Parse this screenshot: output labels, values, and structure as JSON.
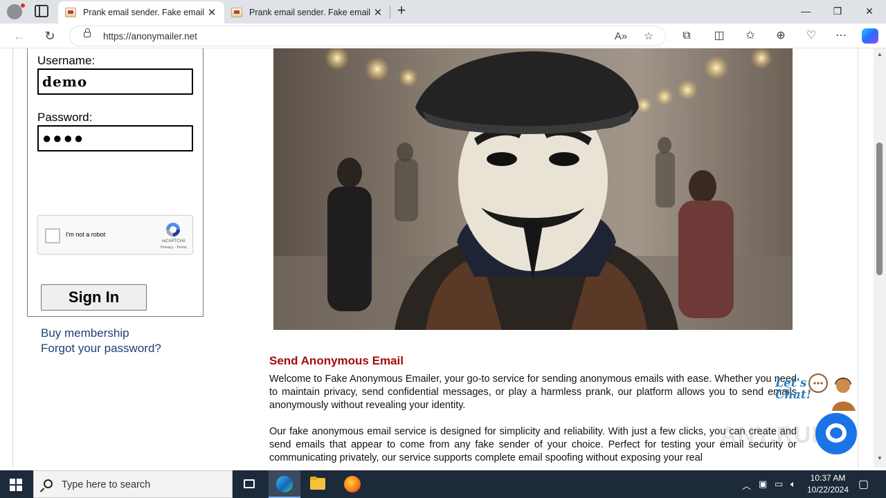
{
  "browser": {
    "tabs": [
      {
        "title": "Prank email sender. Fake email se",
        "active": true
      },
      {
        "title": "Prank email sender. Fake email se",
        "active": false
      }
    ],
    "url": "https://anonymailer.net"
  },
  "login": {
    "username_label": "Username:",
    "username_value": "demo",
    "password_label": "Password:",
    "password_value": "●●●●",
    "captcha_text": "I'm not a robot",
    "captcha_brand": "reCAPTCHA",
    "captcha_terms": "Privacy - Terms",
    "signin_label": "Sign In",
    "buy_link": "Buy membership",
    "forgot_link": "Forgot your password?"
  },
  "content": {
    "title": "Send Anonymous Email",
    "para1": "Welcome to Fake Anonymous Emailer, your go-to service for sending anonymous emails with ease. Whether you need to maintain privacy, send confidential messages, or play a harmless prank, our platform allows you to send emails anonymously without revealing your identity.",
    "para2": "Our fake anonymous email service is designed for simplicity and reliability. With just a few clicks, you can create and send emails that appear to come from any fake sender of your choice. Perfect for testing your email security or communicating privately, our service supports complete email spoofing without exposing your real"
  },
  "chat": {
    "badge_text": "Let's Chat!"
  },
  "watermark": "ANY.RUN",
  "taskbar": {
    "search_placeholder": "Type here to search",
    "time": "10:37 AM",
    "date": "10/22/2024"
  },
  "colors": {
    "title_red": "#a30c0c",
    "link_blue": "#1f3f7a",
    "chat_blue": "#1b73e8",
    "taskbar": "#1c2a3a"
  }
}
